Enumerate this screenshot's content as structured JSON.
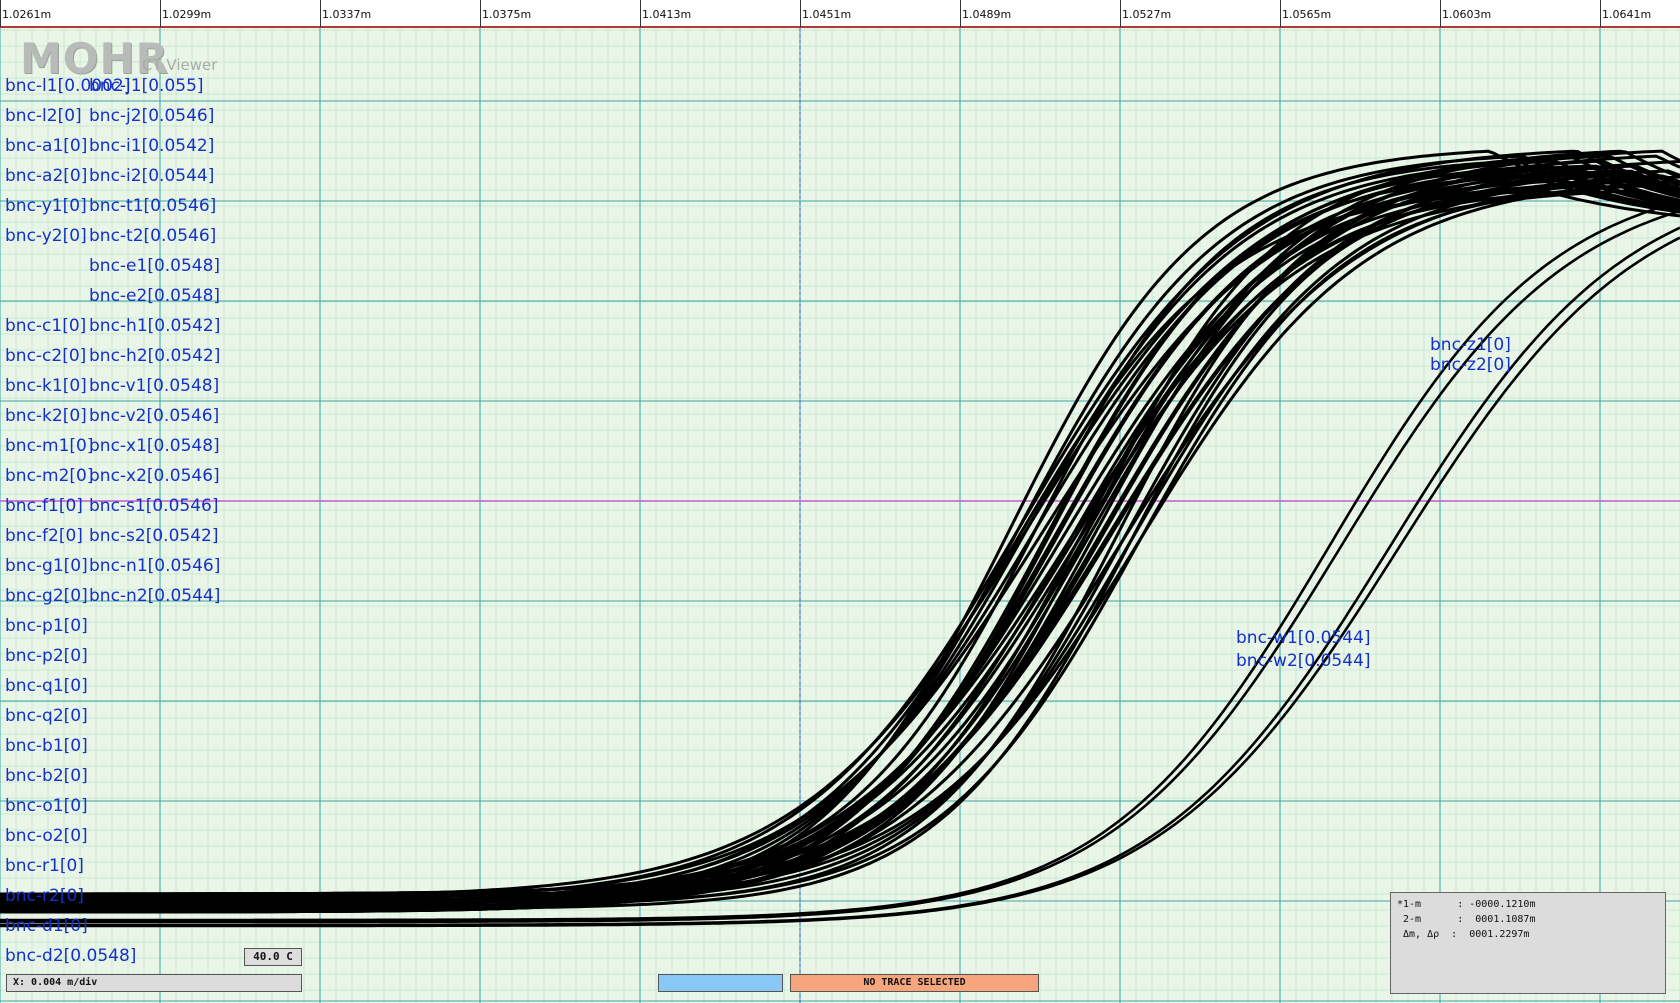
{
  "app": {
    "logo": "MOHR",
    "subtitle": "CT Viewer"
  },
  "ruler": {
    "ticks": [
      "1.0261m",
      "1.0299m",
      "1.0337m",
      "1.0375m",
      "1.0413m",
      "1.0451m",
      "1.0489m",
      "1.0527m",
      "1.0565m",
      "1.0603m",
      "1.0641m"
    ]
  },
  "labels": {
    "left": [
      "bnc-l1[0.0002]",
      "bnc-l2[0]",
      "bnc-a1[0]",
      "bnc-a2[0]",
      "bnc-y1[0]",
      "bnc-y2[0]",
      "",
      "",
      "bnc-c1[0]",
      "bnc-c2[0]",
      "bnc-k1[0]",
      "bnc-k2[0]",
      "bnc-m1[0]",
      "bnc-m2[0]",
      "bnc-f1[0]",
      "bnc-f2[0]",
      "bnc-g1[0]",
      "bnc-g2[0]",
      "bnc-p1[0]",
      "bnc-p2[0]",
      "bnc-q1[0]",
      "bnc-q2[0]",
      "bnc-b1[0]",
      "bnc-b2[0]",
      "bnc-o1[0]",
      "bnc-o2[0]",
      "bnc-r1[0]",
      "bnc-r2[0]",
      "bnc-d1[0]",
      "bnc-d2[0.0548]"
    ],
    "right": [
      "bnc-j1[0.055]",
      "bnc-j2[0.0546]",
      "bnc-i1[0.0542]",
      "bnc-i2[0.0544]",
      "bnc-t1[0.0546]",
      "bnc-t2[0.0546]",
      "bnc-e1[0.0548]",
      "bnc-e2[0.0548]",
      "bnc-h1[0.0542]",
      "bnc-h2[0.0542]",
      "bnc-v1[0.0548]",
      "bnc-v2[0.0546]",
      "bnc-x1[0.0548]",
      "bnc-x2[0.0546]",
      "bnc-s1[0.0546]",
      "bnc-s2[0.0542]",
      "bnc-n1[0.0546]",
      "bnc-n2[0.0544]"
    ],
    "z1": "bnc-z1[0]",
    "z2": "bnc-z2[0]",
    "w1": "bnc-w1[0.0544]",
    "w2": "bnc-w2[0.0544]"
  },
  "bottom": {
    "temperature": "40.0 C",
    "scale": "X: 0.004 m/div",
    "status": "NO TRACE SELECTED"
  },
  "cursor_panel": {
    "rows": [
      "*1-m      : -0000.1210m",
      " 2-m      :  0001.1087m",
      " Δm, Δρ  :  0001.2297m"
    ]
  },
  "colors": {
    "background": "#e9f6e7",
    "grid_minor": "#bfe3cf",
    "grid_major": "#3aa5a5",
    "label": "#1530c8",
    "trace": "#000000",
    "marker": "#c05ad0"
  }
}
